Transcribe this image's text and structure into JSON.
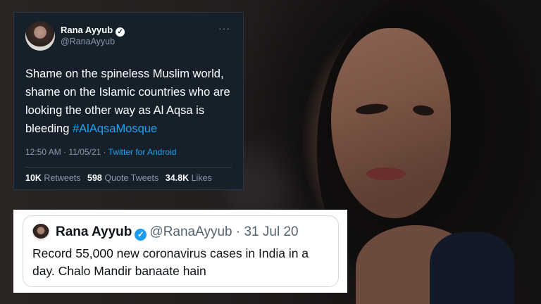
{
  "tweet_main": {
    "author_name": "Rana Ayyub",
    "handle": "@RanaAyyub",
    "more_label": "···",
    "text_before_tag": "Shame on the spineless Muslim world, shame on the Islamic countries who are looking the other way as Al Aqsa is bleeding ",
    "hashtag": "#AlAqsaMosque",
    "time": "12:50 AM",
    "date": "11/05/21",
    "client": "Twitter for Android",
    "retweets_count": "10K",
    "retweets_label": "Retweets",
    "quote_count": "598",
    "quote_label": "Quote Tweets",
    "likes_count": "34.8K",
    "likes_label": "Likes",
    "theme_bg": "#15202b",
    "link_color": "#1da1f2"
  },
  "tweet_quote": {
    "author_name": "Rana Ayyub",
    "handle": "@RanaAyyub",
    "date": "31 Jul 20",
    "text": "Record 55,000 new coronavirus cases in India in a day. Chalo Mandir banaate hain",
    "badge_color": "#1d9bf0"
  },
  "icons": {
    "verified": "verified-badge-icon",
    "more": "more-options-icon"
  }
}
